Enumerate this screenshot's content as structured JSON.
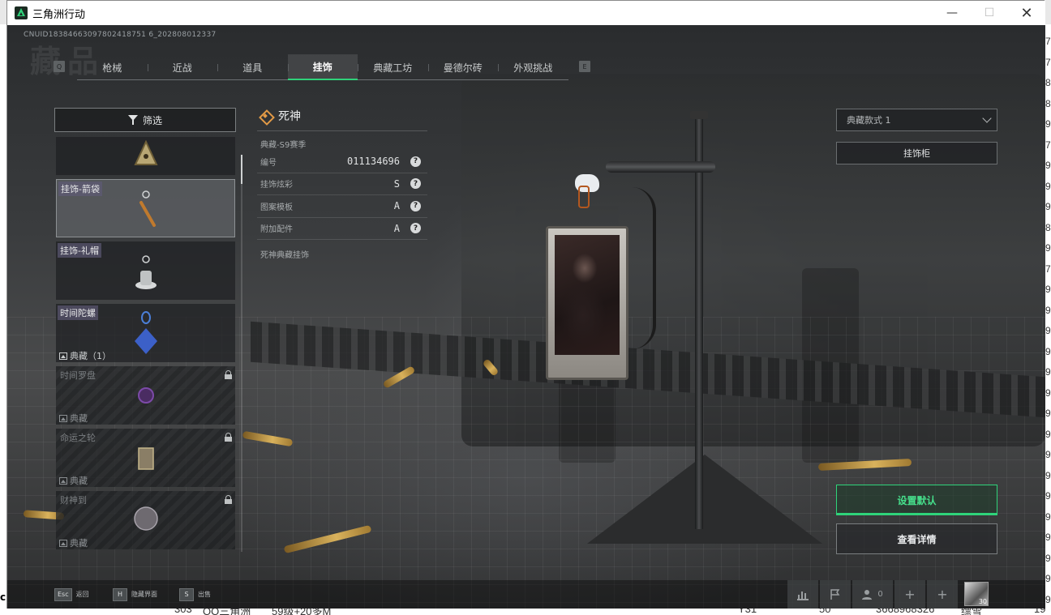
{
  "window": {
    "title": "三角洲行动"
  },
  "window_controls": {
    "minimize": "—",
    "maximize": "☐",
    "close": "✕"
  },
  "uid": "CNUID18384663097802418751 6_202808012337",
  "watermark": "藏品",
  "tabs": [
    {
      "label": "枪械",
      "active": false
    },
    {
      "label": "近战",
      "active": false
    },
    {
      "label": "道具",
      "active": false
    },
    {
      "label": "挂饰",
      "active": true
    },
    {
      "label": "典藏工坊",
      "active": false
    },
    {
      "label": "曼德尔砖",
      "active": false
    },
    {
      "label": "外观挑战",
      "active": false
    }
  ],
  "tab_keys": {
    "prev": "Q",
    "next": "E"
  },
  "filter": {
    "label": "筛选",
    "icon": "filter-icon"
  },
  "items": [
    {
      "label": "",
      "rarity": "",
      "locked": false,
      "selected": false
    },
    {
      "label": "挂饰-箭袋",
      "rarity": "",
      "locked": false,
      "selected": true
    },
    {
      "label": "挂饰-礼帽",
      "rarity": "",
      "locked": false,
      "selected": false
    },
    {
      "label": "时间陀螺",
      "rarity": "典藏（1）",
      "locked": false,
      "selected": false
    },
    {
      "label": "时间罗盘",
      "rarity": "典藏",
      "locked": true,
      "selected": false
    },
    {
      "label": "命运之轮",
      "rarity": "典藏",
      "locked": true,
      "selected": false
    },
    {
      "label": "财神到",
      "rarity": "典藏",
      "locked": true,
      "selected": false
    }
  ],
  "detail": {
    "name": "死神",
    "season": "典藏-S9赛季",
    "rows": [
      {
        "label": "编号",
        "value": "011134696"
      },
      {
        "label": "挂饰炫彩",
        "value": "S"
      },
      {
        "label": "图案模板",
        "value": "A"
      },
      {
        "label": "附加配件",
        "value": "A"
      }
    ],
    "help": "?",
    "description": "死神典藏挂饰"
  },
  "right_panel": {
    "style_select": "典藏款式 1",
    "cabinet": "挂饰柜",
    "set_default": "设置默认",
    "view_details": "查看详情"
  },
  "footer": {
    "hints": [
      {
        "key": "Esc",
        "label": "返回"
      },
      {
        "key": "H",
        "label": "隐藏界面"
      },
      {
        "key": "S",
        "label": "出售"
      }
    ],
    "team_count": "0",
    "avatar_level": "30",
    "add": "+"
  },
  "background_sheet": {
    "right_digits": [
      "7",
      "7",
      "8",
      "8",
      "9",
      "7",
      "9",
      "9",
      "9",
      "8",
      "9",
      "7",
      "9",
      "9",
      "9",
      "9",
      "9",
      "9",
      "9",
      "9",
      "9",
      "9",
      "9",
      "9",
      "9",
      "9",
      "9",
      "9"
    ],
    "bottom_row": [
      "303",
      "OO三角洲",
      "59级+20多M",
      "Y31",
      "50",
      "3668968326",
      "缥雪",
      "19"
    ],
    "left_glyph": "c"
  },
  "colors": {
    "accent": "#2fd37a",
    "rarity_legendary": "#e39a46"
  }
}
